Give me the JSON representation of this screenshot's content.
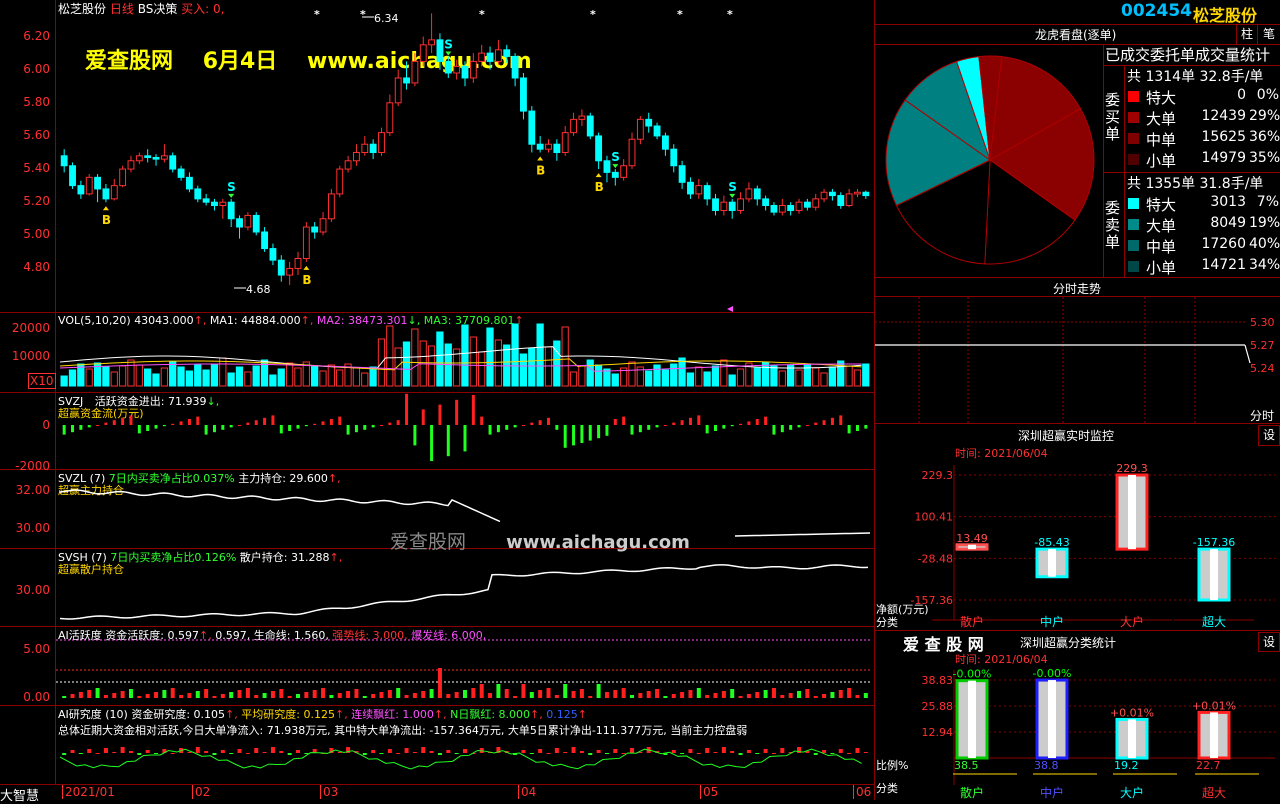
{
  "header": {
    "stock_name": "松芝股份",
    "kline_label": "日线",
    "strategy": "BS决策",
    "buy_label": "买入: 0,"
  },
  "watermark": {
    "site_cn": "爱查股网",
    "date": "6月4日",
    "url": "www.aichagu.com",
    "mid_cn": "爱查股网",
    "mid_url": "www.aichagu.com"
  },
  "price_axis": {
    "ticks": [
      "6.20",
      "6.00",
      "5.80",
      "5.60",
      "5.40",
      "5.20",
      "5.00",
      "4.80"
    ],
    "high_label": "6.34",
    "low_label": "4.68"
  },
  "kline": {
    "colors": {
      "up": "#ff3030",
      "down": "#00ffff"
    },
    "candles": [
      [
        5.48,
        5.42,
        5.52,
        5.38
      ],
      [
        5.42,
        5.3,
        5.44,
        5.28
      ],
      [
        5.3,
        5.25,
        5.33,
        5.22
      ],
      [
        5.25,
        5.35,
        5.37,
        5.24
      ],
      [
        5.35,
        5.28,
        5.37,
        5.2
      ],
      [
        5.28,
        5.22,
        5.31,
        5.2
      ],
      [
        5.22,
        5.3,
        5.34,
        5.21
      ],
      [
        5.3,
        5.4,
        5.42,
        5.29
      ],
      [
        5.4,
        5.45,
        5.48,
        5.38
      ],
      [
        5.45,
        5.48,
        5.5,
        5.43
      ],
      [
        5.48,
        5.47,
        5.52,
        5.44
      ],
      [
        5.47,
        5.46,
        5.49,
        5.42
      ],
      [
        5.46,
        5.48,
        5.55,
        5.44
      ],
      [
        5.48,
        5.4,
        5.5,
        5.38
      ],
      [
        5.4,
        5.35,
        5.42,
        5.33
      ],
      [
        5.35,
        5.28,
        5.38,
        5.26
      ],
      [
        5.28,
        5.22,
        5.3,
        5.2
      ],
      [
        5.22,
        5.2,
        5.25,
        5.18
      ],
      [
        5.2,
        5.18,
        5.22,
        5.15
      ],
      [
        5.18,
        5.2,
        5.22,
        5.1
      ],
      [
        5.2,
        5.1,
        5.22,
        5.05
      ],
      [
        5.1,
        5.05,
        5.12,
        4.98
      ],
      [
        5.05,
        5.12,
        5.14,
        5.03
      ],
      [
        5.12,
        5.02,
        5.14,
        5.0
      ],
      [
        5.02,
        4.92,
        5.05,
        4.9
      ],
      [
        4.92,
        4.85,
        4.95,
        4.82
      ],
      [
        4.85,
        4.76,
        4.88,
        4.72
      ],
      [
        4.76,
        4.8,
        4.84,
        4.7
      ],
      [
        4.8,
        4.86,
        4.9,
        4.76
      ],
      [
        4.86,
        5.05,
        5.08,
        4.84
      ],
      [
        5.05,
        5.02,
        5.08,
        4.98
      ],
      [
        5.02,
        5.1,
        5.14,
        5.0
      ],
      [
        5.1,
        5.25,
        5.28,
        5.08
      ],
      [
        5.25,
        5.4,
        5.42,
        5.23
      ],
      [
        5.4,
        5.45,
        5.48,
        5.38
      ],
      [
        5.45,
        5.5,
        5.55,
        5.42
      ],
      [
        5.5,
        5.55,
        5.6,
        5.48
      ],
      [
        5.55,
        5.5,
        5.58,
        5.46
      ],
      [
        5.5,
        5.62,
        5.65,
        5.48
      ],
      [
        5.62,
        5.8,
        5.85,
        5.6
      ],
      [
        5.8,
        5.95,
        6.0,
        5.78
      ],
      [
        5.95,
        5.92,
        6.05,
        5.88
      ],
      [
        5.92,
        6.05,
        6.1,
        5.9
      ],
      [
        6.05,
        6.15,
        6.2,
        6.02
      ],
      [
        6.15,
        6.18,
        6.34,
        6.1
      ],
      [
        6.18,
        6.05,
        6.22,
        6.0
      ],
      [
        6.05,
        5.98,
        6.08,
        5.95
      ],
      [
        5.98,
        6.02,
        6.06,
        5.94
      ],
      [
        6.02,
        5.95,
        6.05,
        5.9
      ],
      [
        5.95,
        6.05,
        6.1,
        5.92
      ],
      [
        6.05,
        6.1,
        6.15,
        6.02
      ],
      [
        6.1,
        6.05,
        6.14,
        6.0
      ],
      [
        6.05,
        6.12,
        6.18,
        6.03
      ],
      [
        6.12,
        6.08,
        6.15,
        6.04
      ],
      [
        6.08,
        5.95,
        6.1,
        5.9
      ],
      [
        5.95,
        5.75,
        5.98,
        5.7
      ],
      [
        5.75,
        5.55,
        5.78,
        5.5
      ],
      [
        5.55,
        5.52,
        5.6,
        5.5
      ],
      [
        5.52,
        5.55,
        5.58,
        5.5
      ],
      [
        5.55,
        5.5,
        5.58,
        5.45
      ],
      [
        5.5,
        5.62,
        5.66,
        5.48
      ],
      [
        5.62,
        5.7,
        5.74,
        5.6
      ],
      [
        5.7,
        5.72,
        5.76,
        5.66
      ],
      [
        5.72,
        5.6,
        5.74,
        5.58
      ],
      [
        5.6,
        5.45,
        5.62,
        5.4
      ],
      [
        5.45,
        5.38,
        5.48,
        5.32
      ],
      [
        5.38,
        5.35,
        5.4,
        5.3
      ],
      [
        5.35,
        5.42,
        5.46,
        5.33
      ],
      [
        5.42,
        5.58,
        5.62,
        5.4
      ],
      [
        5.58,
        5.7,
        5.72,
        5.55
      ],
      [
        5.7,
        5.66,
        5.74,
        5.62
      ],
      [
        5.66,
        5.6,
        5.68,
        5.58
      ],
      [
        5.6,
        5.52,
        5.62,
        5.48
      ],
      [
        5.52,
        5.42,
        5.55,
        5.38
      ],
      [
        5.42,
        5.32,
        5.45,
        5.28
      ],
      [
        5.32,
        5.25,
        5.35,
        5.22
      ],
      [
        5.25,
        5.3,
        5.34,
        5.22
      ],
      [
        5.3,
        5.22,
        5.32,
        5.18
      ],
      [
        5.22,
        5.15,
        5.25,
        5.12
      ],
      [
        5.15,
        5.2,
        5.24,
        5.12
      ],
      [
        5.2,
        5.15,
        5.22,
        5.1
      ],
      [
        5.15,
        5.22,
        5.26,
        5.13
      ],
      [
        5.22,
        5.28,
        5.32,
        5.2
      ],
      [
        5.28,
        5.22,
        5.3,
        5.18
      ],
      [
        5.22,
        5.18,
        5.24,
        5.15
      ],
      [
        5.18,
        5.14,
        5.2,
        5.12
      ],
      [
        5.14,
        5.18,
        5.22,
        5.12
      ],
      [
        5.18,
        5.15,
        5.2,
        5.12
      ],
      [
        5.15,
        5.2,
        5.22,
        5.13
      ],
      [
        5.2,
        5.17,
        5.22,
        5.15
      ],
      [
        5.17,
        5.22,
        5.25,
        5.15
      ],
      [
        5.22,
        5.26,
        5.28,
        5.2
      ],
      [
        5.26,
        5.24,
        5.28,
        5.21
      ],
      [
        5.24,
        5.18,
        5.26,
        5.16
      ],
      [
        5.18,
        5.25,
        5.28,
        5.17
      ],
      [
        5.25,
        5.26,
        5.28,
        5.23
      ],
      [
        5.26,
        5.24,
        5.27,
        5.22
      ]
    ],
    "markers": [
      {
        "i": 5,
        "label": "B"
      },
      {
        "i": 20,
        "label": "S"
      },
      {
        "i": 29,
        "label": "B"
      },
      {
        "i": 46,
        "label": "S"
      },
      {
        "i": 57,
        "label": "B"
      },
      {
        "i": 64,
        "label": "B"
      },
      {
        "i": 66,
        "label": "S"
      },
      {
        "i": 80,
        "label": "S"
      }
    ],
    "stars_x": [
      318,
      364,
      483,
      594,
      681,
      731
    ]
  },
  "vol_panel": {
    "title": "VOL(5,10,20)",
    "value": "43043.000",
    "ma1": "MA1: 44884.000",
    "ma2": "MA2: 38473.301",
    "ma3": "MA3: 37709.801",
    "ticks": [
      "20000",
      "10000"
    ],
    "x10": "X10"
  },
  "svzj_panel": {
    "title": "SVZJ",
    "indicator": "活跃资金进出: 71.939",
    "subtitle": "超赢资金流(万元)",
    "ticks": [
      "0",
      "-2000"
    ]
  },
  "svzl_panel": {
    "title": "SVZL (7)",
    "ratio": "7日内买卖净占比0.037%",
    "holding": "主力持仓: 29.600",
    "subtitle": "超赢主力持仓",
    "ticks": [
      "32.00",
      "30.00"
    ]
  },
  "svsh_panel": {
    "title": "SVSH (7)",
    "ratio": "7日内买卖净占比0.126%",
    "holding": "散户持仓: 31.288",
    "subtitle": "超赢散户持仓",
    "ticks": [
      "30.00"
    ]
  },
  "ai_active_panel": {
    "title": "AI活跃度",
    "activity": "资金活跃度: 0.597",
    "activity2": "0.597,",
    "life": "生命线: 1.560,",
    "strong": "强势线: 3.000,",
    "burst": "爆发线: 6.000,",
    "ticks": [
      "5.00",
      "0.00"
    ]
  },
  "ai_research_panel": {
    "title": "AI研究度 (10)",
    "research": "资金研究度: 0.105",
    "avg": "平均研究度: 0.125",
    "lianxu": "连续飘红: 1.000",
    "nday": "N日飘红: 8.000",
    "tail": "0.125",
    "summary": "总体近期大资金相对活跃,今日大单净流入: 71.938万元, 其中特大单净流出: -157.364万元, 大单5日累计净出-111.377万元, 当前主力控盘弱"
  },
  "bottom_axis": {
    "brand": "大智慧",
    "labels": [
      "2021/01",
      "02",
      "03",
      "04",
      "05",
      "06"
    ]
  },
  "right_panel": {
    "code": "002454",
    "name": "松芝股份",
    "btn1": "柱",
    "btn2": "笔",
    "pie_title": "龙虎看盘(逐单)",
    "stats_title": "已成交委托单成交量统计",
    "buy_label": "委买单",
    "sell_label": "委卖单",
    "buy_total": "共 1314单 32.8手/单",
    "sell_total": "共 1355单 31.8手/单",
    "buy_rows": [
      {
        "name": "特大",
        "val": "0",
        "pct": "0%",
        "color": "#ff0000"
      },
      {
        "name": "大单",
        "val": "12439",
        "pct": "29%",
        "color": "#a00000"
      },
      {
        "name": "中单",
        "val": "15625",
        "pct": "36%",
        "color": "#800000"
      },
      {
        "name": "小单",
        "val": "14979",
        "pct": "35%",
        "color": "#500000"
      }
    ],
    "sell_rows": [
      {
        "name": "特大",
        "val": "3013",
        "pct": "7%",
        "color": "#00ffff"
      },
      {
        "name": "大单",
        "val": "8049",
        "pct": "19%",
        "color": "#008b8b"
      },
      {
        "name": "中单",
        "val": "17260",
        "pct": "40%",
        "color": "#006a6a"
      },
      {
        "name": "小单",
        "val": "14721",
        "pct": "34%",
        "color": "#004848"
      }
    ],
    "pie_slices": [
      {
        "pct": 0.16,
        "color": "#8b0000"
      },
      {
        "pct": 0.18,
        "color": "#8b0000"
      },
      {
        "pct": 0.16,
        "color": "#000"
      },
      {
        "pct": 0.17,
        "color": "#000"
      },
      {
        "pct": 0.17,
        "color": "#008080"
      },
      {
        "pct": 0.1,
        "color": "#008080"
      },
      {
        "pct": 0.035,
        "color": "#00ffff"
      },
      {
        "pct": 0.035,
        "color": "#8b0000"
      }
    ],
    "timeline_title": "分时走势",
    "timeline_ticks": [
      "5.30",
      "5.27",
      "5.24"
    ],
    "timeline_label": "分时",
    "monitor_title": "深圳超赢实时监控",
    "monitor_btn": "设",
    "monitor_time": "时间: 2021/06/04",
    "monitor_ticks": [
      "229.3",
      "100.41",
      "-28.48",
      "-157.36"
    ],
    "monitor_unit": "净额(万元)",
    "monitor_cat_label": "分类",
    "monitor_bars": [
      {
        "name": "散户",
        "value": "13.49",
        "v": 13.49
      },
      {
        "name": "中户",
        "value": "-85.43",
        "v": -85.43
      },
      {
        "name": "大户",
        "value": "229.3",
        "v": 229.3
      },
      {
        "name": "超大",
        "value": "-157.36",
        "v": -157.36
      }
    ],
    "class_brand": "爱 查 股 网",
    "class_title": "深圳超赢分类统计",
    "class_btn": "设",
    "class_time": "时间: 2021/06/04",
    "class_ticks": [
      "38.83",
      "25.88",
      "12.94"
    ],
    "class_ratio_label": "比例%",
    "class_cat_label": "分类",
    "class_bars": [
      {
        "name": "散户",
        "top": "-0.00%",
        "bottom": "38.5",
        "v": 38.5,
        "color": "#00cc00"
      },
      {
        "name": "中户",
        "top": "-0.00%",
        "bottom": "38.8",
        "v": 38.8,
        "color": "#2020ff"
      },
      {
        "name": "大户",
        "top": "+0.01%",
        "bottom": "19.2",
        "v": 19.2,
        "color": "#00ffff"
      },
      {
        "name": "超大",
        "top": "+0.01%",
        "bottom": "22.7",
        "v": 22.7,
        "color": "#ff2020"
      }
    ]
  }
}
